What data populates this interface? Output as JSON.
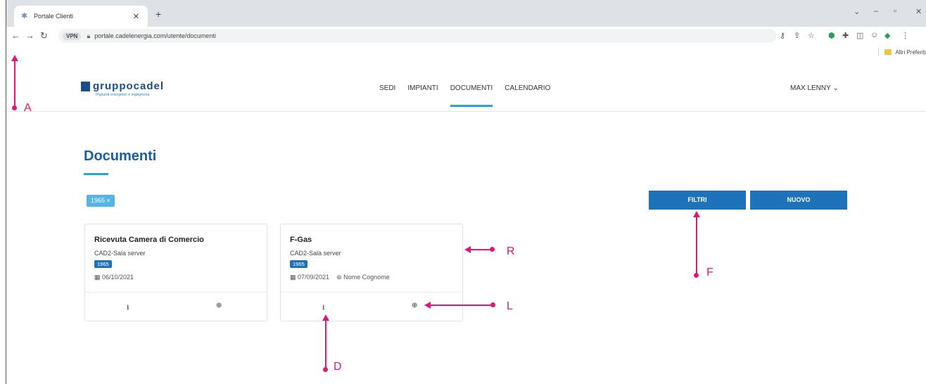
{
  "browser": {
    "tab_title": "Portale Clienti",
    "url": "portale.cadelenergia.com/utente/documenti",
    "vpn_label": "VPN",
    "bookmarks_label": "Altri Preferiti"
  },
  "site": {
    "logo_text": "gruppocadel",
    "logo_tagline": "Impianti energetici e ingegneria",
    "nav": [
      "SEDI",
      "IMPIANTI",
      "DOCUMENTI",
      "CALENDARIO"
    ],
    "active_nav": "DOCUMENTI",
    "user_label": "MAX LENNY ⌄"
  },
  "page": {
    "title": "Documenti",
    "filter_chip": "1965 ×",
    "filter_button": "FILTRI",
    "new_button": "NUOVO"
  },
  "cards": [
    {
      "title": "Ricevuta Camera di Comercio",
      "location": "CAD2-Sala server",
      "badge": "1965",
      "date": "▦ 06/10/2021",
      "user": ""
    },
    {
      "title": "F-Gas",
      "location": "CAD2-Sala server",
      "badge": "1965",
      "date": "▦ 07/09/2021",
      "user": "⊛ Nome Cognome"
    }
  ],
  "annotations": {
    "a": "A",
    "r": "R",
    "f": "F",
    "l": "L",
    "d": "D"
  },
  "colors": {
    "accent": "#2aa3dc",
    "primary": "#1d72b8",
    "annotation": "#e0167b"
  }
}
